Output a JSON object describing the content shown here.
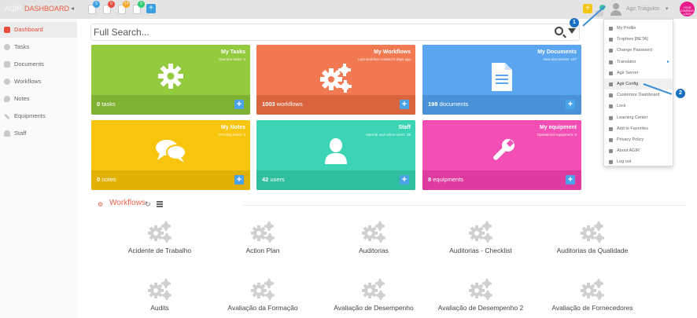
{
  "header": {
    "brand": "AGIR",
    "section": "DASHBOARD",
    "collapse_glyph": "◂",
    "notifications": [
      {
        "icon": "tasks-icon",
        "badge": "5",
        "color": "#3aa0e0"
      },
      {
        "icon": "workflows-icon",
        "badge": "0",
        "color": "#e74c3c"
      },
      {
        "icon": "documents-icon",
        "badge": "14",
        "color": "#f5a623"
      },
      {
        "icon": "notes-icon",
        "badge": "0",
        "color": "#2ecc71"
      }
    ],
    "add_label": "+",
    "quick_add_label": "+",
    "user_name": "Agir.Triágulos",
    "user_caret": "▾",
    "logo_text": "YOUR COMPANY LOGO"
  },
  "sidebar": {
    "items": [
      {
        "label": "Dashboard",
        "icon": "home-icon",
        "active": true
      },
      {
        "label": "Tasks",
        "icon": "gear-icon",
        "active": false
      },
      {
        "label": "Documents",
        "icon": "document-icon",
        "active": false
      },
      {
        "label": "Workflows",
        "icon": "gears-icon",
        "active": false
      },
      {
        "label": "Notes",
        "icon": "comments-icon",
        "active": false
      },
      {
        "label": "Equipments",
        "icon": "wrench-icon",
        "active": false
      },
      {
        "label": "Staff",
        "icon": "user-icon",
        "active": false
      }
    ]
  },
  "search": {
    "placeholder": "Full Search..."
  },
  "tiles": [
    {
      "title": "My Tasks",
      "subtitle": "Overdue tasks: 0",
      "count": "0",
      "count_label": "tasks",
      "add": "+",
      "color": "#93ca3e",
      "foot_color": "#7fb233",
      "icon": "gear-icon"
    },
    {
      "title": "My Workflows",
      "subtitle": "Last workflow created 8 days ago",
      "count": "1003",
      "count_label": "workflows",
      "add": "+",
      "color": "#f17a52",
      "foot_color": "#d9643e",
      "icon": "gears-icon"
    },
    {
      "title": "My Documents",
      "subtitle": "New documents: 107",
      "count": "198",
      "count_label": "documents",
      "add": "+",
      "color": "#5aa6f0",
      "foot_color": "#4a92d8",
      "icon": "document-icon"
    },
    {
      "title": "My Notes",
      "subtitle": "Pending notes: 0",
      "count": "0",
      "count_label": "notes",
      "add": "+",
      "color": "#f8c50e",
      "foot_color": "#e2b106",
      "icon": "comments-icon"
    },
    {
      "title": "Staff",
      "subtitle": "Internal and online users: 38",
      "count": "42",
      "count_label": "users",
      "add": "+",
      "color": "#3bd5b5",
      "foot_color": "#2fbf9f",
      "icon": "user-icon"
    },
    {
      "title": "My equipment",
      "subtitle": "Operational equipment: 0",
      "count": "8",
      "count_label": "equipments",
      "add": "+",
      "color": "#f24eb3",
      "foot_color": "#de3a9f",
      "icon": "wrench-icon"
    }
  ],
  "workflows": {
    "title": "Workflows",
    "items": [
      "Acidente de Trabalho",
      "Action Plan",
      "Auditorias",
      "Auditorias - Checklist",
      "Auditorias da Qualidade",
      "Audits",
      "Avaliação da Formação",
      "Avaliação de Desempenho",
      "Avaliação de Desempenho 2",
      "Avaliação de Fornecedores"
    ]
  },
  "user_menu": {
    "items": [
      {
        "label": "My Profile",
        "icon": "user-icon"
      },
      {
        "label": "Trophies [BETA]",
        "icon": "trophy-icon"
      },
      {
        "label": "Change Password",
        "icon": "key-icon"
      },
      {
        "label": "Translator",
        "icon": "globe-icon",
        "submenu": true
      },
      {
        "label": "Agir Server",
        "icon": "envelope-icon"
      },
      {
        "label": "Agir Config",
        "icon": "wrench-icon",
        "highlighted": true
      },
      {
        "label": "Customize Dashboard",
        "icon": "flag-icon"
      },
      {
        "label": "Lock",
        "icon": "lock-icon"
      },
      {
        "label": "Learning Center",
        "icon": "question-icon"
      },
      {
        "label": "Add to Favorites",
        "icon": "star-icon"
      },
      {
        "label": "Privacy Policy",
        "icon": "lock-icon"
      },
      {
        "label": "About AGIR",
        "icon": "info-icon"
      },
      {
        "label": "Log out",
        "icon": "power-icon"
      }
    ],
    "submenu_arrow": "▸"
  },
  "annotations": [
    {
      "number": "1"
    },
    {
      "number": "2"
    }
  ]
}
